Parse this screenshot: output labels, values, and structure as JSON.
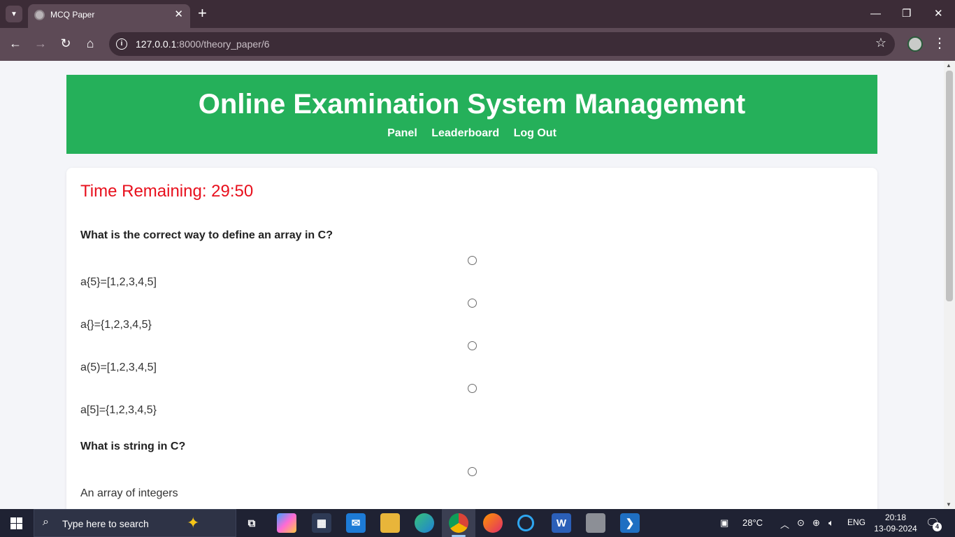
{
  "browser": {
    "tab_title": "MCQ Paper",
    "tab_close": "✕",
    "new_tab": "+",
    "url_host": "127.0.0.1",
    "url_path": ":8000/theory_paper/6"
  },
  "page": {
    "header_title": "Online Examination System Management",
    "nav": [
      "Panel",
      "Leaderboard",
      "Log Out"
    ],
    "timer": "Time Remaining: 29:50",
    "questions": [
      {
        "text": "What is the correct way to define an array in C?",
        "options": [
          "a{5}=[1,2,3,4,5]",
          "a{}={1,2,3,4,5}",
          "a(5)=[1,2,3,4,5]",
          "a[5]={1,2,3,4,5}"
        ]
      },
      {
        "text": "What is string in C?",
        "options": [
          "An array of integers"
        ]
      }
    ]
  },
  "taskbar": {
    "search_placeholder": "Type here to search",
    "weather": "28°C",
    "language": "ENG",
    "time": "20:18",
    "date": "13-09-2024",
    "notification_count": "4"
  },
  "colors": {
    "header_bg": "#25b05a",
    "timer": "#e8101d",
    "browser_frame": "#3c2c37",
    "taskbar_bg": "#1f2233"
  }
}
